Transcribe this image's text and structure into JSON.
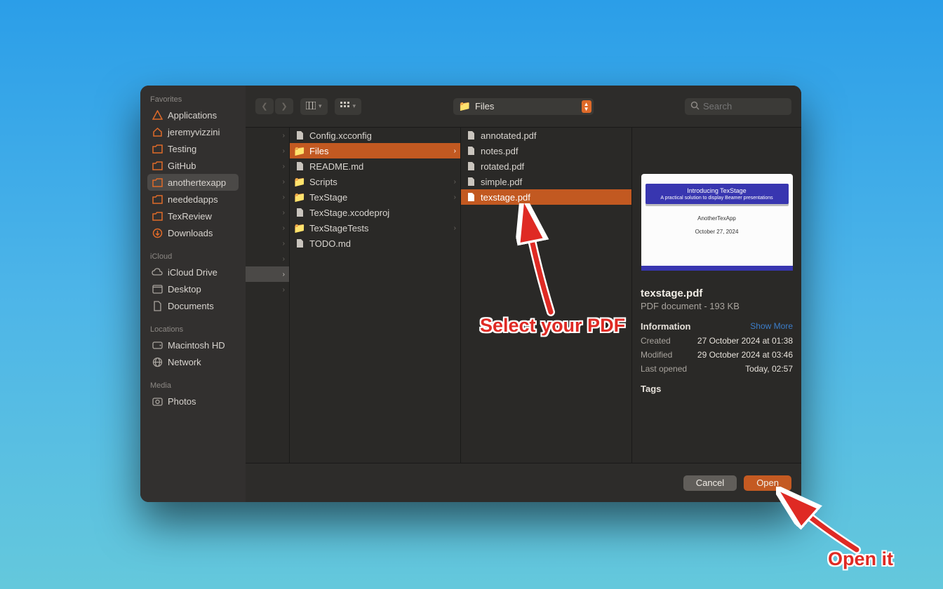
{
  "sidebar": {
    "sections": [
      {
        "title": "Favorites",
        "items": [
          {
            "icon": "apps",
            "label": "Applications"
          },
          {
            "icon": "home",
            "label": "jeremyvizzini"
          },
          {
            "icon": "folder",
            "label": "Testing"
          },
          {
            "icon": "folder",
            "label": "GitHub"
          },
          {
            "icon": "folder",
            "label": "anothertexapp",
            "selected": true
          },
          {
            "icon": "folder",
            "label": "neededapps"
          },
          {
            "icon": "folder",
            "label": "TexReview"
          },
          {
            "icon": "down",
            "label": "Downloads"
          }
        ]
      },
      {
        "title": "iCloud",
        "items": [
          {
            "icon": "cloud",
            "label": "iCloud Drive"
          },
          {
            "icon": "desktop",
            "label": "Desktop"
          },
          {
            "icon": "doc",
            "label": "Documents"
          }
        ]
      },
      {
        "title": "Locations",
        "items": [
          {
            "icon": "hd",
            "label": "Macintosh HD"
          },
          {
            "icon": "net",
            "label": "Network"
          }
        ]
      },
      {
        "title": "Media",
        "items": [
          {
            "icon": "photo",
            "label": "Photos"
          }
        ]
      }
    ]
  },
  "toolbar": {
    "path_label": "Files",
    "search_placeholder": "Search"
  },
  "columns": {
    "col0_rows": 11,
    "col0_selected_index": 9,
    "col1": [
      {
        "type": "file",
        "name": "Config.xcconfig"
      },
      {
        "type": "folder",
        "name": "Files",
        "selected": true,
        "children": true
      },
      {
        "type": "file",
        "name": "README.md"
      },
      {
        "type": "folder",
        "name": "Scripts",
        "children": true
      },
      {
        "type": "folder",
        "name": "TexStage",
        "children": true
      },
      {
        "type": "file",
        "name": "TexStage.xcodeproj"
      },
      {
        "type": "folder",
        "name": "TexStageTests",
        "children": true
      },
      {
        "type": "file",
        "name": "TODO.md"
      }
    ],
    "col2": [
      {
        "type": "file",
        "name": "annotated.pdf"
      },
      {
        "type": "file",
        "name": "notes.pdf"
      },
      {
        "type": "file",
        "name": "rotated.pdf"
      },
      {
        "type": "file",
        "name": "simple.pdf"
      },
      {
        "type": "file",
        "name": "texstage.pdf",
        "selected": true
      }
    ]
  },
  "preview": {
    "filename": "texstage.pdf",
    "subtitle": "PDF document - 193 KB",
    "info_label": "Information",
    "show_more": "Show More",
    "rows": [
      {
        "k": "Created",
        "v": "27 October 2024 at 01:38"
      },
      {
        "k": "Modified",
        "v": "29 October 2024 at 03:46"
      },
      {
        "k": "Last opened",
        "v": "Today, 02:57"
      }
    ],
    "tags_label": "Tags",
    "thumbnail": {
      "title": "Introducing TexStage",
      "subtitle": "A practical solution to display Beamer presentations",
      "author": "AnotherTexApp",
      "date": "October 27, 2024"
    }
  },
  "footer": {
    "cancel": "Cancel",
    "open": "Open"
  },
  "annotations": {
    "select_pdf": "Select your PDF",
    "open_it": "Open it"
  }
}
